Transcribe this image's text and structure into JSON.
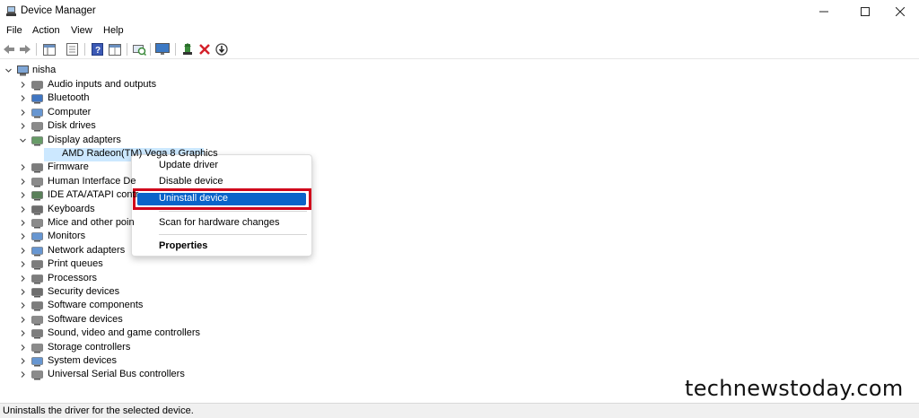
{
  "window": {
    "title": "Device Manager"
  },
  "menu": [
    "File",
    "Action",
    "View",
    "Help"
  ],
  "tree": {
    "root": "nisha",
    "categories": [
      "Audio inputs and outputs",
      "Bluetooth",
      "Computer",
      "Disk drives",
      "Display adapters",
      "AMD Radeon(TM) Vega 8 Graphics",
      "Firmware",
      "Human Interface De",
      "IDE ATA/ATAPI contr",
      "Keyboards",
      "Mice and other poin",
      "Monitors",
      "Network adapters",
      "Print queues",
      "Processors",
      "Security devices",
      "Software components",
      "Software devices",
      "Sound, video and game controllers",
      "Storage controllers",
      "System devices",
      "Universal Serial Bus controllers"
    ]
  },
  "context_menu": {
    "items": [
      "Update driver",
      "Disable device",
      "Uninstall device",
      "Scan for hardware changes",
      "Properties"
    ],
    "highlighted": "Uninstall device"
  },
  "status": {
    "text": "Uninstalls the driver for the selected device."
  },
  "watermark": "technewstoday.com",
  "colors": {
    "highlight": "#0a63c9",
    "annotation": "#d0021b",
    "selection": "#cce8ff"
  }
}
